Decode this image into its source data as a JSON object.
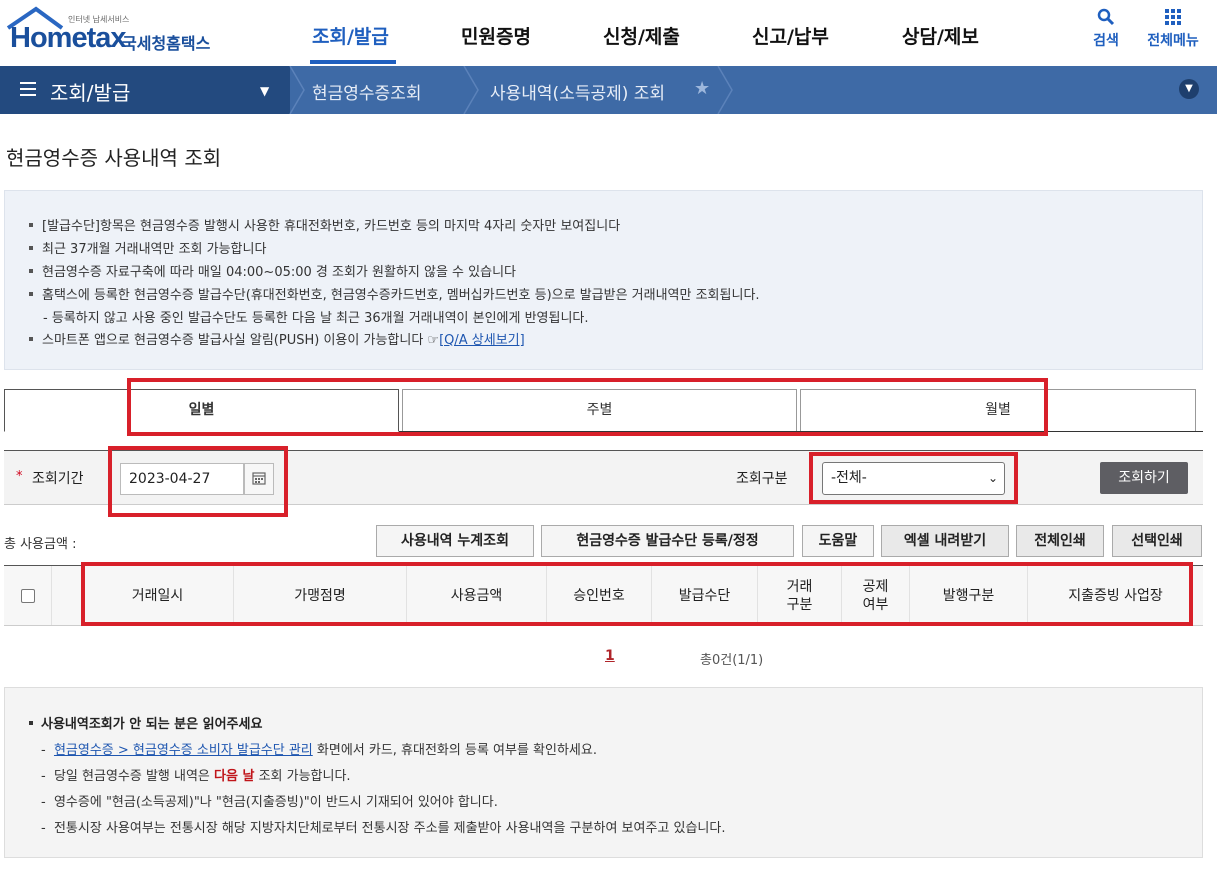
{
  "header": {
    "logo_sub": "인터넷 납세서비스",
    "logo_text": "Hometax",
    "logo_brand": "국세청홈택스",
    "gnb": [
      "조회/발급",
      "민원증명",
      "신청/제출",
      "신고/납부",
      "상담/제보"
    ],
    "util_search": "검색",
    "util_menu": "전체메뉴"
  },
  "breadcrumb": {
    "menu": "조회/발급",
    "level1": "현금영수증조회",
    "level2": "사용내역(소득공제) 조회"
  },
  "page_title": "현금영수증 사용내역 조회",
  "notice": [
    "[발급수단]항목은 현금영수증 발행시 사용한 휴대전화번호, 카드번호 등의 마지막 4자리 숫자만 보여집니다",
    "최근 37개월 거래내역만 조회 가능합니다",
    "현금영수증 자료구축에 따라 매일 04:00~05:00 경 조회가 원활하지 않을 수 있습니다",
    "홈택스에 등록한 현금영수증 발급수단(휴대전화번호, 현금영수증카드번호, 멤버십카드번호 등)으로 발급받은 거래내역만 조회됩니다.",
    "- 등록하지 않고 사용 중인 발급수단도 등록한 다음 날 최근 36개월 거래내역이 본인에게 반영됩니다.",
    "스마트폰 앱으로 현금영수증 발급사실 알림(PUSH) 이용이 가능합니다 ☞"
  ],
  "notice_link": "[Q/A 상세보기]",
  "tabs": [
    "일별",
    "주별",
    "월별"
  ],
  "search": {
    "period_label": "조회기간",
    "date_value": "2023-04-27",
    "gubun_label": "조회구분",
    "gubun_selected": "-전체-",
    "search_button": "조회하기"
  },
  "toolbar": {
    "total_label": "총 사용금액 :",
    "buttons": [
      "사용내역 누계조회",
      "현금영수증 발급수단 등록/정정",
      "도움말",
      "엑셀 내려받기",
      "전체인쇄",
      "선택인쇄"
    ]
  },
  "table": {
    "headers": [
      "거래일시",
      "가맹점명",
      "사용금액",
      "승인번호",
      "발급수단",
      "거래\n구분",
      "공제\n여부",
      "발행구분",
      "지출증빙 사업장"
    ]
  },
  "pagination": {
    "page": "1",
    "count": "총0건(1/1)"
  },
  "guide": {
    "title": "사용내역조회가 안 되는 분은 읽어주세요",
    "line1_link": "현금영수증 > 현금영수증 소비자 발급수단 관리",
    "line1_rest": " 화면에서 카드, 휴대전화의 등록 여부를 확인하세요.",
    "line2_pre": "당일 현금영수증 발행 내역은 ",
    "line2_em": "다음 날",
    "line2_post": " 조회 가능합니다.",
    "line3": "영수증에 \"현금(소득공제)\"나 \"현금(지출증빙)\"이 반드시 기재되어 있어야 합니다.",
    "line4": "전통시장 사용여부는 전통시장 해당 지방자치단체로부터 전통시장 주소를 제출받아 사용내역을 구분하여 보여주고 있습니다.",
    "dash": "-"
  },
  "colors": {
    "accent": "#1f5fbf",
    "nav_dark": "#234a7f",
    "nav": "#3e6aa6",
    "highlight_box": "#d8202a",
    "emphasis": "#c0151a"
  }
}
